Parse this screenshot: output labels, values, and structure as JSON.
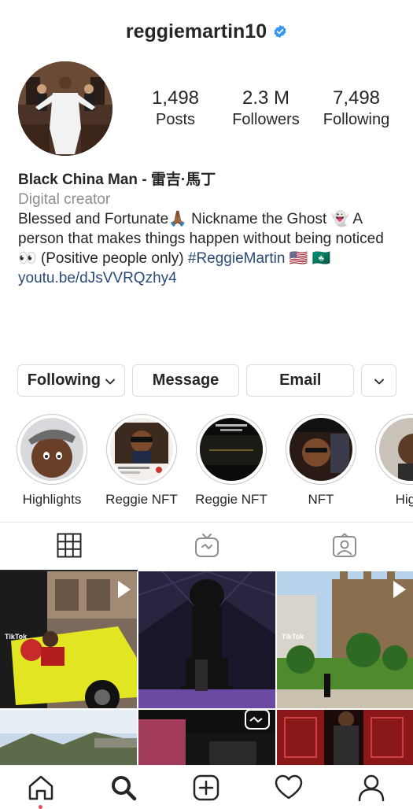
{
  "header": {
    "username": "reggiemartin10",
    "verified_icon": "verified-badge-icon"
  },
  "stats": [
    {
      "number": "1,498",
      "label": "Posts"
    },
    {
      "number": "2.3 M",
      "label": "Followers"
    },
    {
      "number": "7,498",
      "label": "Following"
    }
  ],
  "bio": {
    "name": "Black China Man - 雷吉·馬丁",
    "category": "Digital creator",
    "text_1": "Blessed and Fortunate🙏🏾 Nickname the Ghost 👻 A person that makes things happen without being noticed👀 (Positive people only) ",
    "hashtag": "#ReggieMartin",
    "text_2": " 🇺🇸 🇲🇴",
    "link": "youtu.be/dJsVVRQzhy4"
  },
  "actions": {
    "following_label": "Following",
    "message_label": "Message",
    "email_label": "Email"
  },
  "highlights": [
    {
      "label": "Highlights"
    },
    {
      "label": "Reggie NFT"
    },
    {
      "label": "Reggie NFT"
    },
    {
      "label": "NFT"
    },
    {
      "label": "Highl"
    }
  ],
  "tabs": [
    "grid-icon",
    "igtv-icon",
    "tagged-icon"
  ],
  "grid_badges": {
    "tiktok": "TikTok"
  },
  "bottom_nav": [
    "home-icon",
    "search-icon",
    "new-post-icon",
    "activity-icon",
    "profile-icon"
  ],
  "colors": {
    "accent_link": "#2a4a78",
    "verified": "#3897f0",
    "notification_dot": "#ed4956"
  }
}
